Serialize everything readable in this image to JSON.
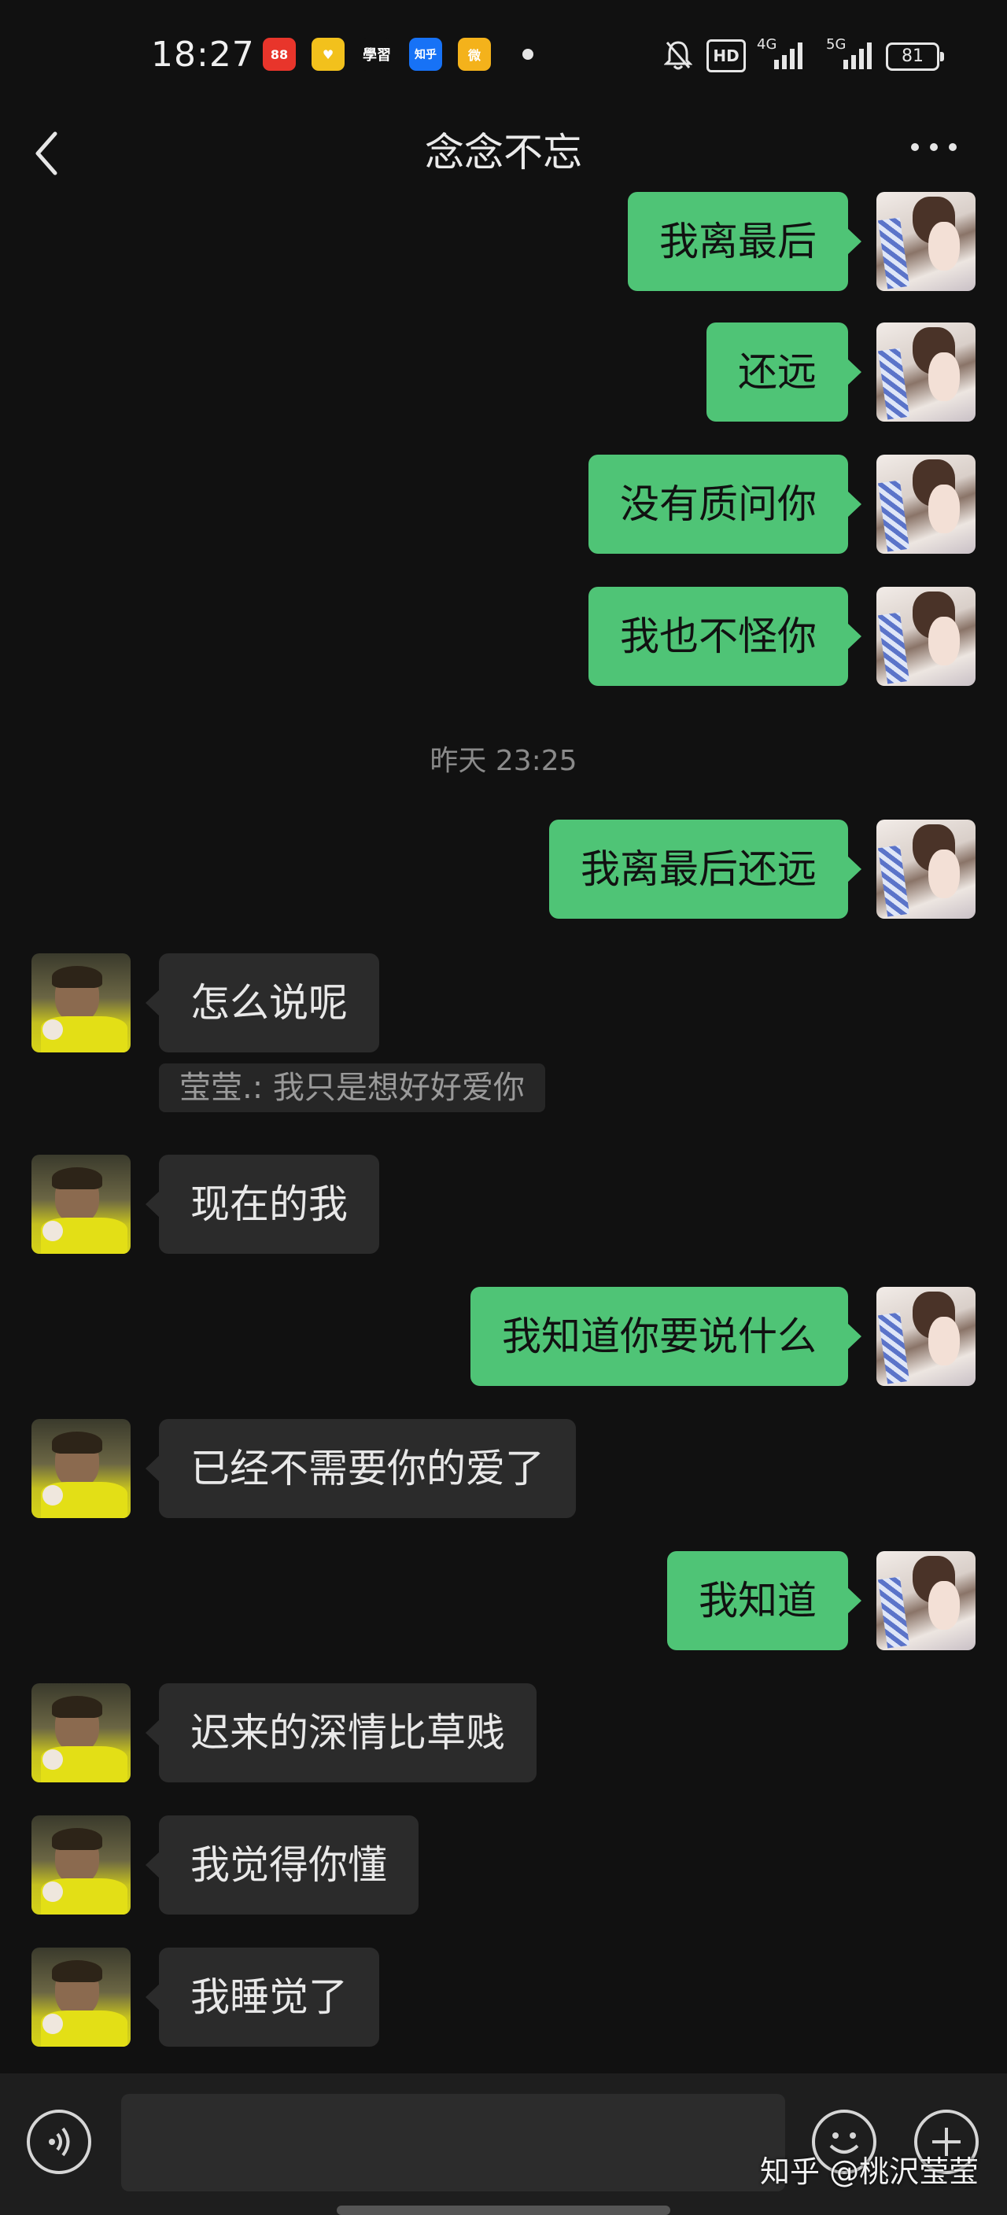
{
  "status_bar": {
    "time": "18:27",
    "app_icons": [
      {
        "name": "kuaishou-icon",
        "color": "#e8352b",
        "text": "88"
      },
      {
        "name": "yellow-app-icon",
        "color": "#f2c11c",
        "text": "♥"
      },
      {
        "name": "xuexi-icon",
        "color": "#111111",
        "text": "學習"
      },
      {
        "name": "zhihu-icon",
        "color": "#1772f6",
        "text": "知乎"
      },
      {
        "name": "weibo-icon",
        "color": "#f4b21b",
        "text": "微"
      }
    ],
    "network": [
      "HD",
      "4G",
      "5G"
    ],
    "battery": "81"
  },
  "header": {
    "title": "念念不忘"
  },
  "messages": [
    {
      "side": "me",
      "text": "我离最后"
    },
    {
      "side": "me",
      "text": "还远"
    },
    {
      "side": "me",
      "text": "没有质问你"
    },
    {
      "side": "me",
      "text": "我也不怪你"
    },
    {
      "side": "time",
      "text": "昨天 23:25"
    },
    {
      "side": "me",
      "text": "我离最后还远"
    },
    {
      "side": "them",
      "text": "怎么说呢",
      "quote": "莹莹.:  我只是想好好爱你"
    },
    {
      "side": "them",
      "text": "现在的我"
    },
    {
      "side": "me",
      "text": "我知道你要说什么"
    },
    {
      "side": "them",
      "text": "已经不需要你的爱了"
    },
    {
      "side": "me",
      "text": "我知道"
    },
    {
      "side": "them",
      "text": "迟来的深情比草贱"
    },
    {
      "side": "them",
      "text": "我觉得你懂"
    },
    {
      "side": "them",
      "text": "我睡觉了"
    }
  ],
  "watermark": "知乎 @桃沢莹莹",
  "colors": {
    "background": "#111111",
    "sent_bubble": "#4fc476",
    "received_bubble": "#2b2b2b"
  }
}
